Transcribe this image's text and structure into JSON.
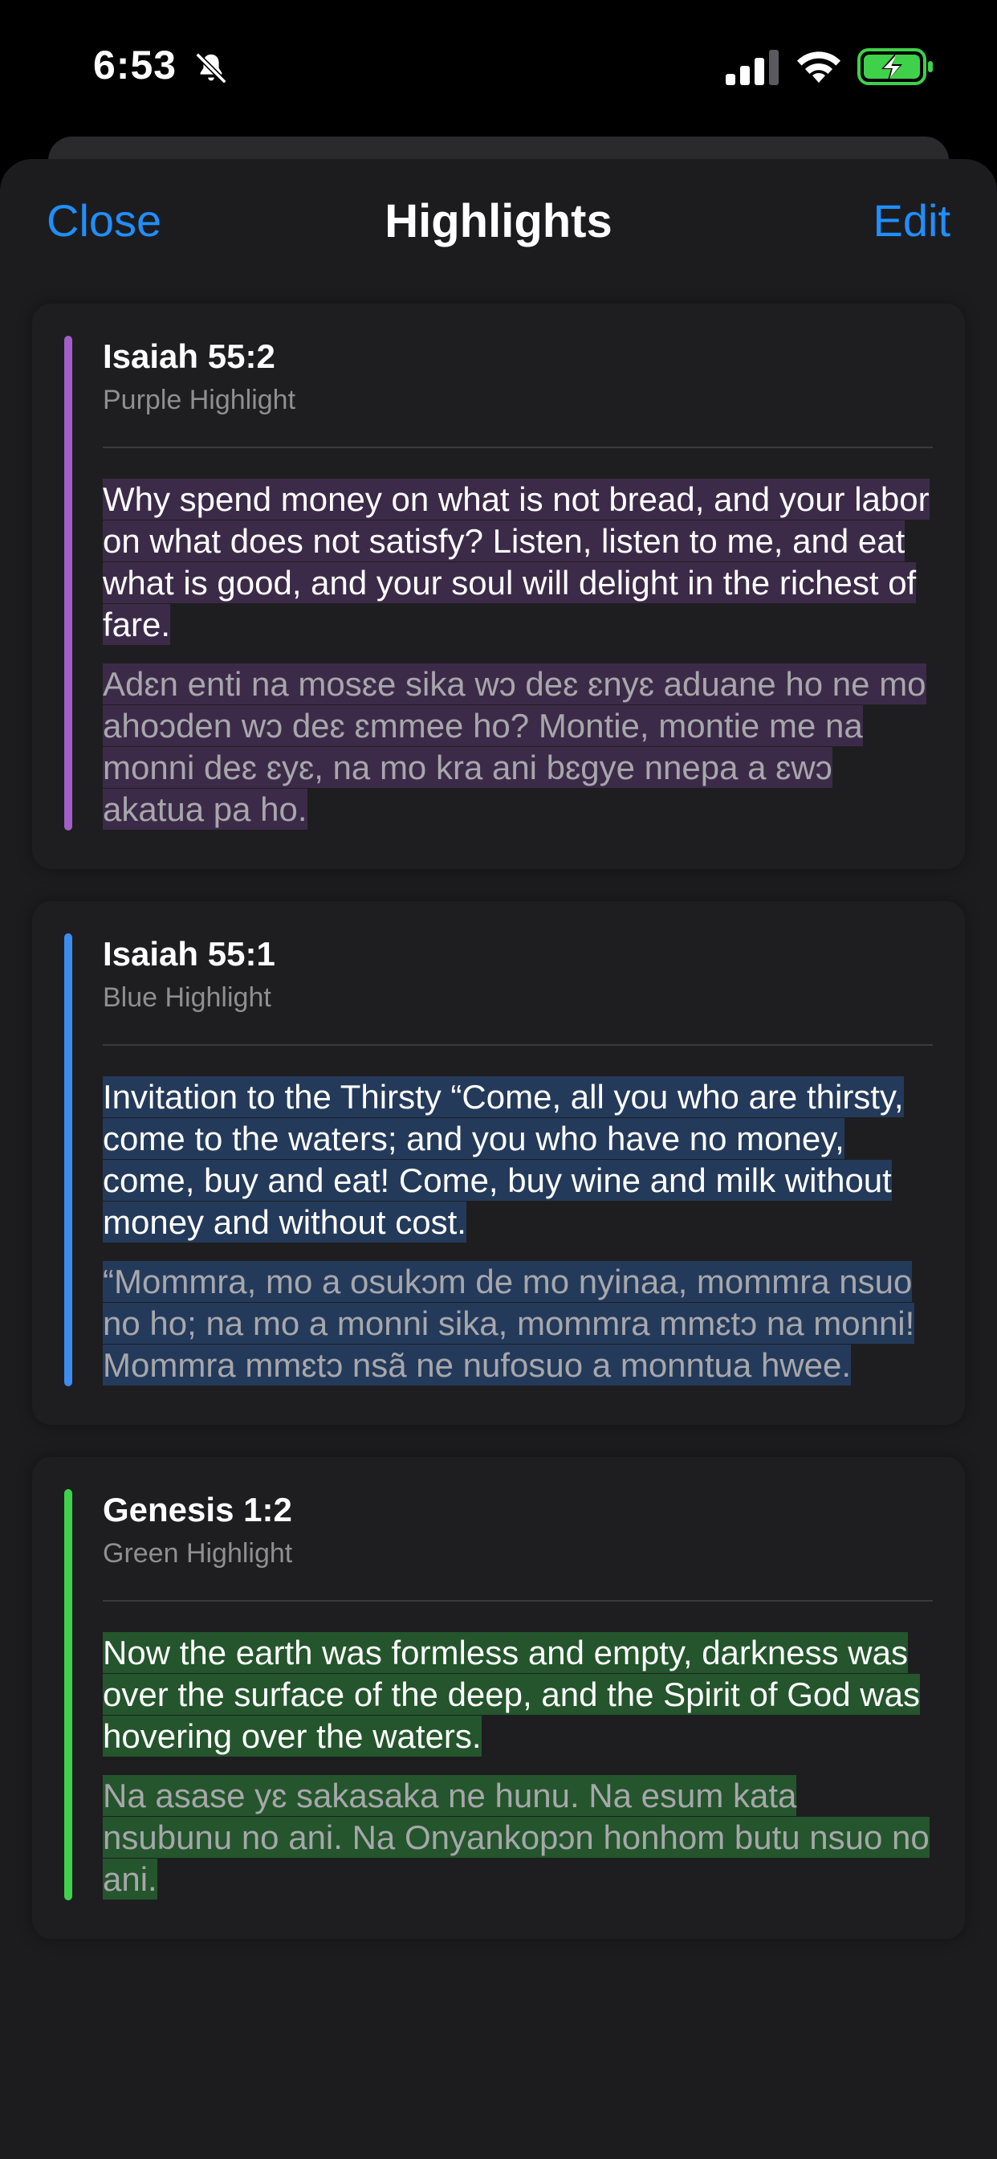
{
  "status_bar": {
    "time": "6:53",
    "icons": [
      "bell-slash-icon",
      "cellular-signal-icon",
      "wifi-icon",
      "battery-charging-icon"
    ]
  },
  "nav": {
    "close_label": "Close",
    "title": "Highlights",
    "edit_label": "Edit"
  },
  "highlights": [
    {
      "reference": "Isaiah 55:2",
      "color_name": "Purple Highlight",
      "bar_color": "#a35fc9",
      "highlight_bg": "#3c2b48",
      "verse": "Why spend money on what is not bread, and your labor on what does not satisfy? Listen, listen to me, and eat what is good, and your soul will delight in the richest of fare.",
      "translation": "Adɛn enti na mosɛe sika wɔ deɛ ɛnyɛ aduane ho ne mo ahoɔden wɔ deɛ ɛmmee ho? Montie, montie me na monni deɛ ɛyɛ, na mo kra ani bɛgye nnepa a ɛwɔ akatua pa ho."
    },
    {
      "reference": "Isaiah 55:1",
      "color_name": "Blue Highlight",
      "bar_color": "#3d8cf0",
      "highlight_bg": "#243a5a",
      "verse": "Invitation to the Thirsty “Come, all you who are thirsty, come to the waters; and you who have no money, come, buy and eat! Come, buy wine and milk without money and without cost.",
      "translation": "“Mommra, mo a osukɔm de mo nyinaa, mommra nsuo no ho; na mo a monni sika, mommra mmɛtɔ na monni! Mommra mmɛtɔ nsã ne nufosuo a monntua hwee."
    },
    {
      "reference": "Genesis 1:2",
      "color_name": "Green Highlight",
      "bar_color": "#3fd14a",
      "highlight_bg": "#24552c",
      "verse": "Now the earth was formless and empty, darkness was over the surface of the deep, and the Spirit of God was hovering over the waters.",
      "translation": "Na asase yɛ sakasaka ne hunu. Na esum kata nsubunu no ani. Na Onyankopɔn honhom butu nsuo no ani."
    }
  ]
}
